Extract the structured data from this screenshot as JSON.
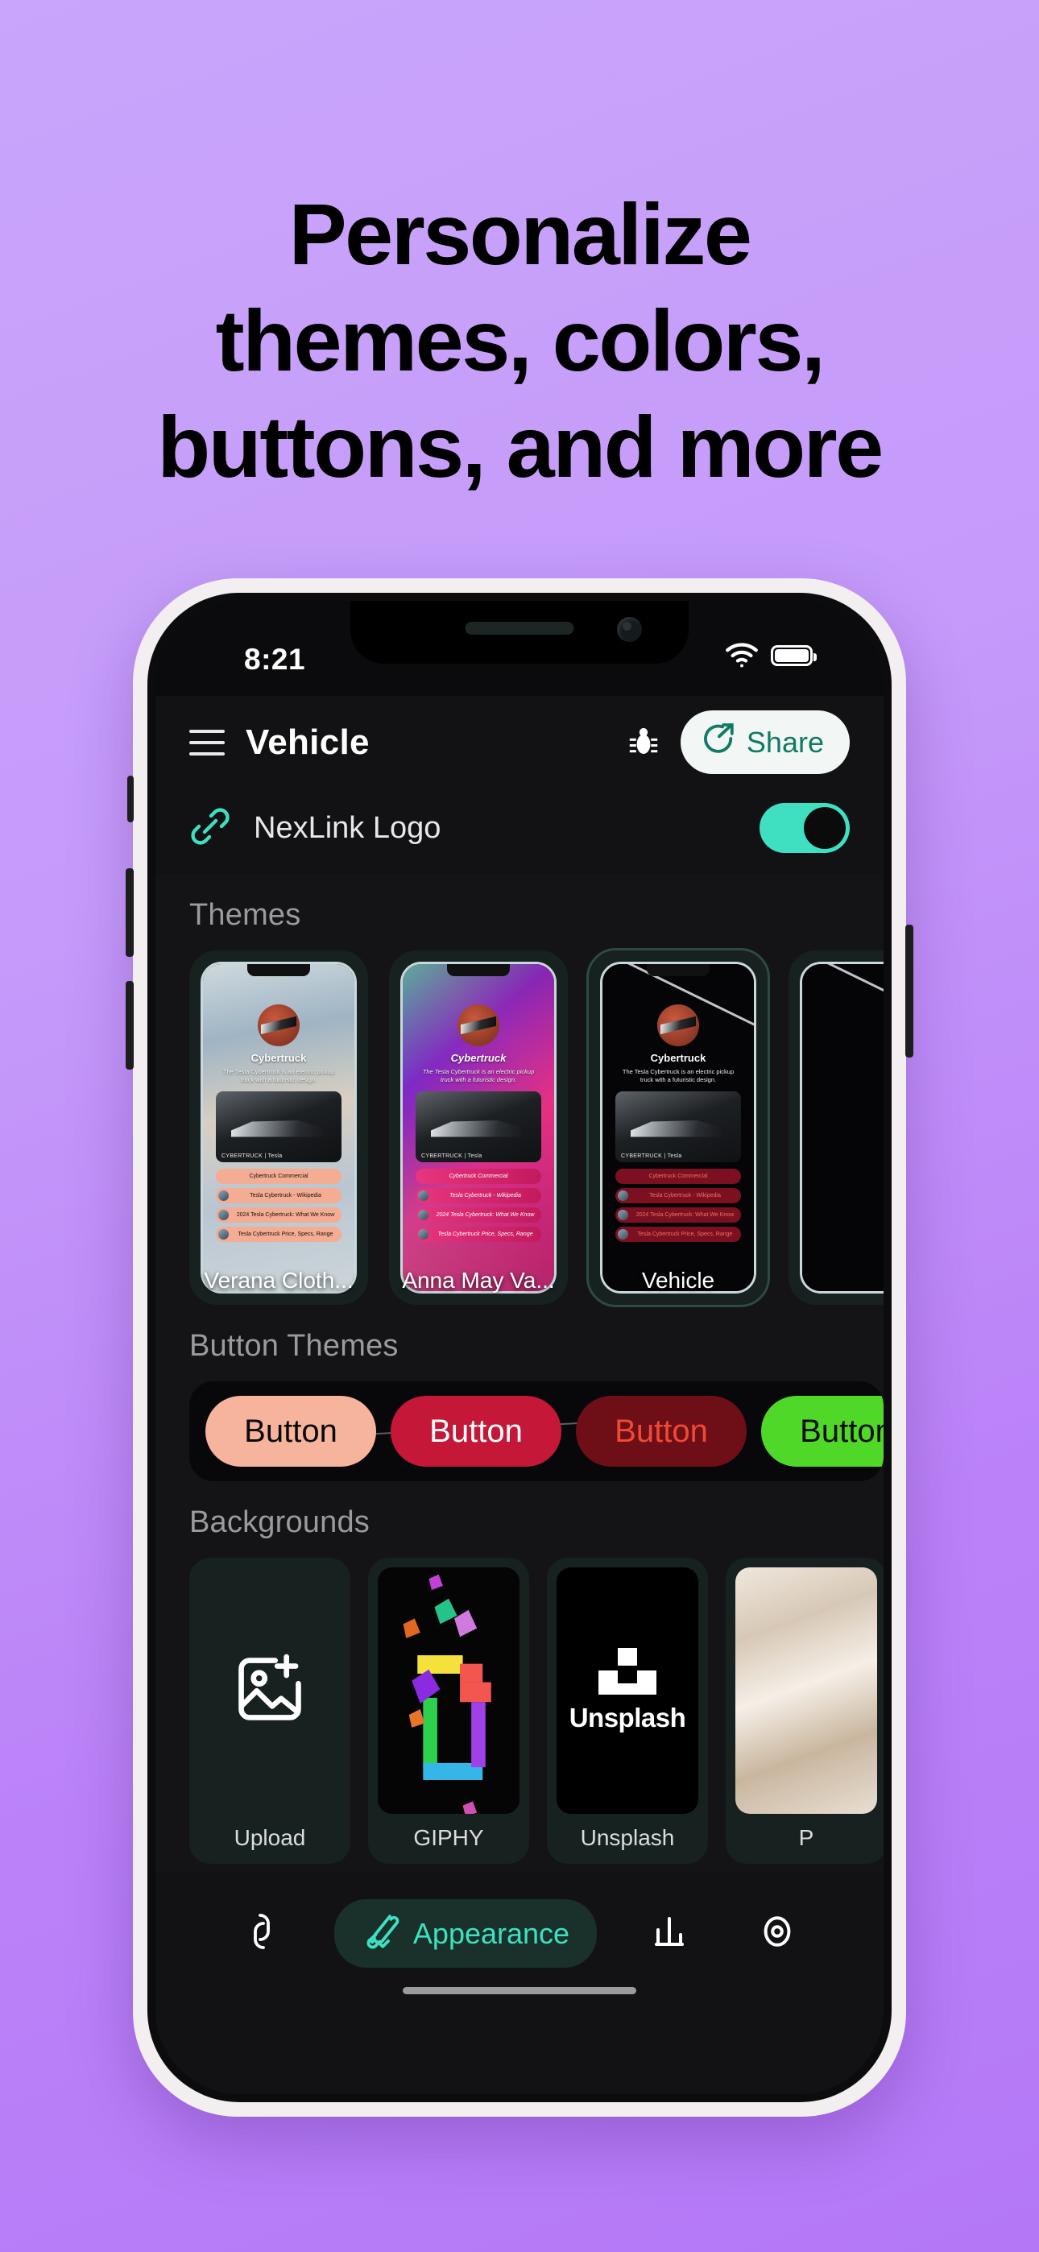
{
  "headline": {
    "lines": [
      "Personalize",
      "themes, colors,",
      "buttons, and more"
    ]
  },
  "colors": {
    "background_gradient_start": "#c9a5fb",
    "background_gradient_end": "#b478f7",
    "accent_teal": "#3ee0c1",
    "share_text": "#117a63",
    "screen_bg": "#141416"
  },
  "status_bar": {
    "time": "8:21",
    "wifi_icon": "wifi-icon",
    "battery_icon": "battery-icon"
  },
  "app_header": {
    "menu_icon": "hamburger-menu-icon",
    "title": "Vehicle",
    "bug_icon": "bug-icon",
    "share_icon": "share-arrow-icon",
    "share_label": "Share"
  },
  "nexlink": {
    "link_icon": "link-chain-icon",
    "label": "NexLink Logo",
    "toggle_state": "on"
  },
  "sections": {
    "themes": {
      "title": "Themes",
      "cards": [
        {
          "label": "Verana Cloth...",
          "selected": false,
          "preview": {
            "profile_name": "Cybertruck",
            "description": "The Tesla Cybertruck is an electric pickup truck with a futuristic design.",
            "media_caption": "CYBERTRUCK | Tesla",
            "links": [
              "Cybertruck Commercial",
              "Tesla Cybertruck - Wikipedia",
              "2024 Tesla Cybertruck: What We Know",
              "Tesla Cybertruck Price, Specs, Range"
            ]
          }
        },
        {
          "label": "Anna May Va...",
          "selected": false,
          "preview": {
            "profile_name": "Cybertruck",
            "description": "The Tesla Cybertruck is an electric pickup truck with a futuristic design.",
            "media_caption": "CYBERTRUCK | Tesla",
            "links": [
              "Cybertruck Commercial",
              "Tesla Cybertruck - Wikipedia",
              "2024 Tesla Cybertruck: What We Know",
              "Tesla Cybertruck Price, Specs, Range"
            ]
          }
        },
        {
          "label": "Vehicle",
          "selected": true,
          "preview": {
            "profile_name": "Cybertruck",
            "description": "The Tesla Cybertruck is an electric pickup truck with a futuristic design.",
            "media_caption": "CYBERTRUCK | Tesla",
            "links": [
              "Cybertruck Commercial",
              "Tesla Cybertruck - Wikipedia",
              "2024 Tesla Cybertruck: What We Know",
              "Tesla Cybertruck Price, Specs, Range"
            ]
          }
        }
      ]
    },
    "button_themes": {
      "title": "Button Themes",
      "buttons": [
        {
          "label": "Button",
          "bg": "#f6b49c",
          "fg": "#0a0a0a"
        },
        {
          "label": "Button",
          "bg": "#c51838",
          "fg": "#ffffff"
        },
        {
          "label": "Button",
          "bg": "#6e0f18",
          "fg": "#ef4a34"
        },
        {
          "label": "Button",
          "bg": "#4fd828",
          "fg": "#0a0a0a"
        }
      ]
    },
    "backgrounds": {
      "title": "Backgrounds",
      "cards": [
        {
          "label": "Upload",
          "icon": "image-plus-icon"
        },
        {
          "label": "GIPHY",
          "icon": "giphy-thumbnail"
        },
        {
          "label": "Unsplash",
          "icon": "unsplash-logo-icon"
        },
        {
          "label": "P",
          "icon": "pexels-thumbnail"
        }
      ]
    }
  },
  "tab_bar": {
    "tabs": [
      {
        "label": "",
        "icon": "links-icon",
        "active": false
      },
      {
        "label": "Appearance",
        "icon": "paintbrush-icon",
        "active": true
      },
      {
        "label": "",
        "icon": "bar-chart-icon",
        "active": false
      },
      {
        "label": "",
        "icon": "eye-preview-icon",
        "active": false
      }
    ]
  }
}
